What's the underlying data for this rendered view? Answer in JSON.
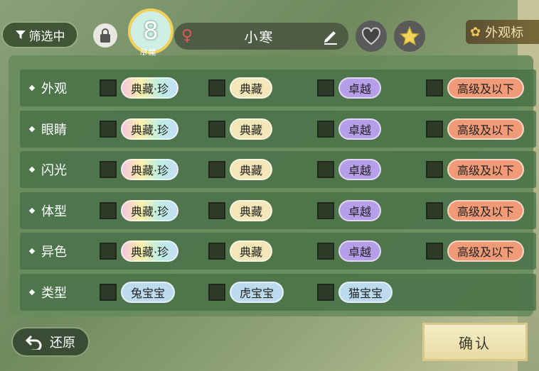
{
  "header": {
    "filter_label": "筛选中",
    "level": "8",
    "level_label": "灵属",
    "name": "小寒",
    "appearance_tab": "外观标"
  },
  "filters": {
    "rows": [
      {
        "label": "外观",
        "options": [
          "典藏·珍",
          "典藏",
          "卓越",
          "高级及以下"
        ]
      },
      {
        "label": "眼睛",
        "options": [
          "典藏·珍",
          "典藏",
          "卓越",
          "高级及以下"
        ]
      },
      {
        "label": "闪光",
        "options": [
          "典藏·珍",
          "典藏",
          "卓越",
          "高级及以下"
        ]
      },
      {
        "label": "体型",
        "options": [
          "典藏·珍",
          "典藏",
          "卓越",
          "高级及以下"
        ]
      },
      {
        "label": "异色",
        "options": [
          "典藏·珍",
          "典藏",
          "卓越",
          "高级及以下"
        ]
      },
      {
        "label": "类型",
        "options": [
          "兔宝宝",
          "虎宝宝",
          "猫宝宝"
        ]
      }
    ]
  },
  "footer": {
    "reset_label": "还原",
    "confirm_label": "确认"
  },
  "colors": {
    "rare_pill": "#fbf2a8",
    "collection_pill": "#f3e6b8",
    "excellent_pill": "#b69ee8",
    "low_pill": "#f09a78",
    "type_pill": "#bcdbee"
  }
}
